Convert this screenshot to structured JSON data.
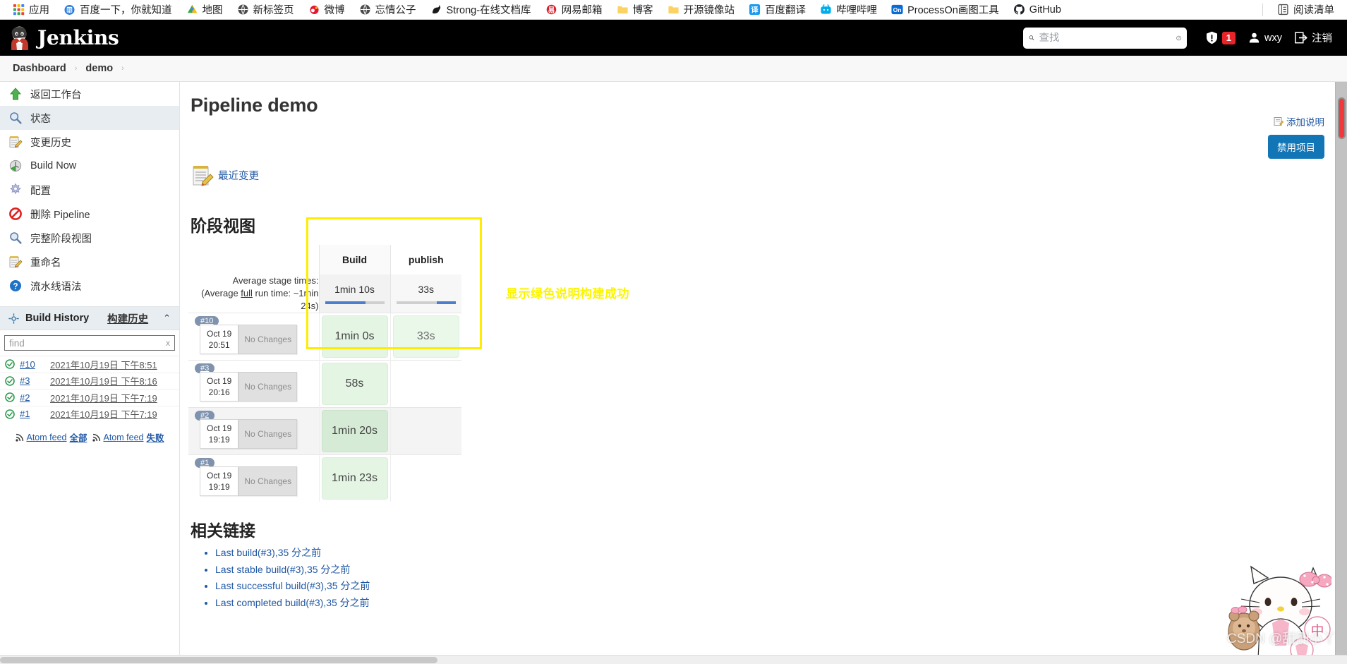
{
  "browser": {
    "bookmarks": [
      {
        "label": "应用",
        "icon": "apps-grid-icon"
      },
      {
        "label": "百度一下，你就知道",
        "icon": "baidu-icon"
      },
      {
        "label": "地图",
        "icon": "maps-icon"
      },
      {
        "label": "新标签页",
        "icon": "globe-icon"
      },
      {
        "label": "微博",
        "icon": "weibo-icon"
      },
      {
        "label": "忘情公子",
        "icon": "globe-icon"
      },
      {
        "label": "Strong-在线文档库",
        "icon": "swan-icon"
      },
      {
        "label": "网易邮箱",
        "icon": "netease-icon"
      },
      {
        "label": "博客",
        "icon": "folder-icon"
      },
      {
        "label": "开源镜像站",
        "icon": "folder-icon"
      },
      {
        "label": "百度翻译",
        "icon": "translate-icon"
      },
      {
        "label": "哔哩哔哩",
        "icon": "bilibili-icon"
      },
      {
        "label": "ProcessOn画图工具",
        "icon": "processon-icon"
      },
      {
        "label": "GitHub",
        "icon": "github-icon"
      }
    ],
    "reading_list": {
      "label": "阅读清单",
      "icon": "reading-list-icon"
    }
  },
  "header": {
    "brand": "Jenkins",
    "search": {
      "placeholder": "查找",
      "value": ""
    },
    "security_badge": "1",
    "user": "wxy",
    "logout": "注销"
  },
  "breadcrumb": {
    "items": [
      "Dashboard",
      "demo"
    ],
    "separator": "›"
  },
  "sidebar": {
    "items": [
      {
        "label": "返回工作台",
        "icon": "up-arrow-icon",
        "active": false
      },
      {
        "label": "状态",
        "icon": "magnifier-icon",
        "active": true
      },
      {
        "label": "变更历史",
        "icon": "notepad-edit-icon",
        "active": false
      },
      {
        "label": "Build Now",
        "icon": "clock-play-icon",
        "active": false
      },
      {
        "label": "配置",
        "icon": "gear-icon",
        "active": false
      },
      {
        "label": "删除 Pipeline",
        "icon": "delete-forbidden-icon",
        "active": false
      },
      {
        "label": "完整阶段视图",
        "icon": "magnifier-icon",
        "active": false
      },
      {
        "label": "重命名",
        "icon": "notepad-edit-icon",
        "active": false
      },
      {
        "label": "流水线语法",
        "icon": "help-circle-icon",
        "active": false
      }
    ],
    "build_history": {
      "title": "Build History",
      "link": "构建历史",
      "collapse_icon": "chevron-up-icon",
      "find": {
        "placeholder": "find",
        "value": "",
        "clear": "x"
      },
      "builds": [
        {
          "number": "#10",
          "date": "2021年10月19日 下午8:51",
          "status": "success"
        },
        {
          "number": "#3",
          "date": "2021年10月19日 下午8:16",
          "status": "success"
        },
        {
          "number": "#2",
          "date": "2021年10月19日 下午7:19",
          "status": "success"
        },
        {
          "number": "#1",
          "date": "2021年10月19日 下午7:19",
          "status": "success"
        }
      ],
      "feeds": [
        {
          "prefix": "Atom feed ",
          "label": "全部"
        },
        {
          "prefix": "Atom feed ",
          "label": "失败"
        }
      ]
    }
  },
  "main": {
    "title": "Pipeline demo",
    "recent_changes": "最近变更",
    "add_description": "添加说明",
    "disable_project": "禁用项目",
    "stage_view_title": "阶段视图",
    "annotation": "显示绿色说明构建成功",
    "related_links_title": "相关链接",
    "related_links": [
      "Last build(#3),35 分之前",
      "Last stable build(#3),35 分之前",
      "Last successful build(#3),35 分之前",
      "Last completed build(#3),35 分之前"
    ]
  },
  "stage_view": {
    "avg_label_line1": "Average stage times:",
    "avg_label_line2_pre": "(Average ",
    "avg_label_full": "full",
    "avg_label_line2_post": " run time: ~1min 24s)",
    "stages": [
      "Build",
      "publish"
    ],
    "averages": [
      "1min 10s",
      "33s"
    ],
    "average_bar_pct": [
      68,
      32
    ],
    "average_bar_align": [
      "left",
      "right"
    ],
    "no_changes": "No Changes",
    "runs": [
      {
        "number": "#10",
        "date": "Oct 19",
        "time": "20:51",
        "cells": [
          {
            "value": "1min 0s",
            "style": "green"
          },
          {
            "value": "33s",
            "style": "green-pale"
          }
        ]
      },
      {
        "number": "#3",
        "date": "Oct 19",
        "time": "20:16",
        "cells": [
          {
            "value": "58s",
            "style": "green"
          },
          {
            "value": "",
            "style": "empty"
          }
        ]
      },
      {
        "number": "#2",
        "date": "Oct 19",
        "time": "19:19",
        "cells": [
          {
            "value": "1min 20s",
            "style": "green-dark"
          },
          {
            "value": "",
            "style": "empty"
          }
        ]
      },
      {
        "number": "#1",
        "date": "Oct 19",
        "time": "19:19",
        "cells": [
          {
            "value": "1min 23s",
            "style": "green"
          },
          {
            "value": "",
            "style": "empty"
          }
        ]
      }
    ]
  },
  "watermark": {
    "text": "CSDN @甜刖小丫"
  },
  "colors": {
    "accent_blue": "#1275b5",
    "link_blue": "#2158a5",
    "highlight_yellow": "#ffec00",
    "annotation_yellow": "#fbf500",
    "badge_red": "#e8242b",
    "stage_green": "#e4f5e4",
    "bar_blue": "#4a7fce"
  }
}
